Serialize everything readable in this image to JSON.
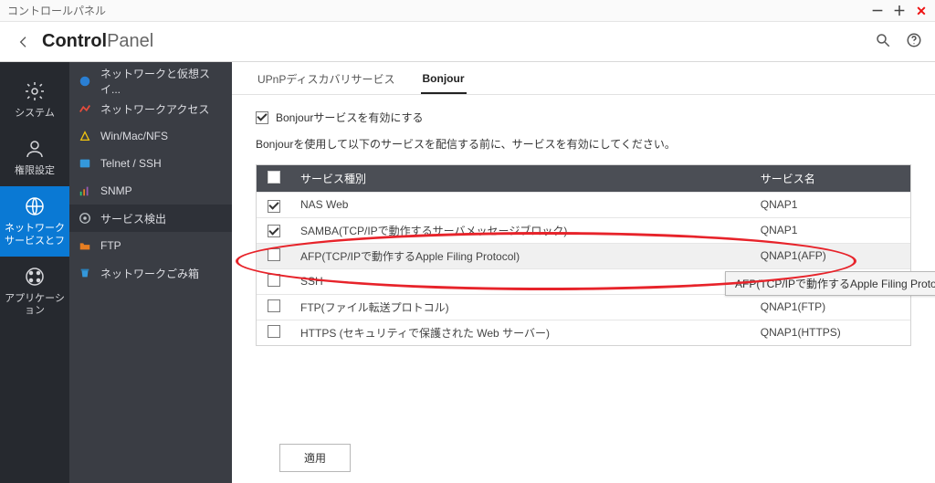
{
  "window": {
    "title": "コントロールパネル"
  },
  "header": {
    "cp_bold": "Control",
    "cp_light": "Panel"
  },
  "left_rail": [
    {
      "label": "システム"
    },
    {
      "label": "権限設定"
    },
    {
      "label": "ネットワークサービスとフ"
    },
    {
      "label": "アプリケーション"
    }
  ],
  "left_sub": [
    {
      "label": "ネットワークと仮想スイ..."
    },
    {
      "label": "ネットワークアクセス"
    },
    {
      "label": "Win/Mac/NFS"
    },
    {
      "label": "Telnet / SSH"
    },
    {
      "label": "SNMP"
    },
    {
      "label": "サービス検出"
    },
    {
      "label": "FTP"
    },
    {
      "label": "ネットワークごみ箱"
    }
  ],
  "tabs": {
    "upnp": "UPnPディスカバリサービス",
    "bonjour": "Bonjour"
  },
  "enable_checkbox_label": "Bonjourサービスを有効にする",
  "desc_text": "Bonjourを使用して以下のサービスを配信する前に、サービスを有効にしてください。",
  "table": {
    "headers": {
      "type": "サービス種別",
      "name": "サービス名"
    },
    "rows": [
      {
        "checked": true,
        "type": "NAS Web",
        "name": "QNAP1"
      },
      {
        "checked": true,
        "type": "SAMBA(TCP/IPで動作するサーバメッセージブロック)",
        "name": "QNAP1"
      },
      {
        "checked": false,
        "type": "AFP(TCP/IPで動作するApple Filing Protocol)",
        "name": "QNAP1(AFP)"
      },
      {
        "checked": false,
        "type": "SSH",
        "name": ""
      },
      {
        "checked": false,
        "type": "FTP(ファイル転送プロトコル)",
        "name": "QNAP1(FTP)"
      },
      {
        "checked": false,
        "type": "HTTPS (セキュリティで保護された Web サーバー)",
        "name": "QNAP1(HTTPS)"
      }
    ]
  },
  "tooltip_text": "AFP(TCP/IPで動作するApple Filing Protocol)",
  "apply_button": "適用"
}
